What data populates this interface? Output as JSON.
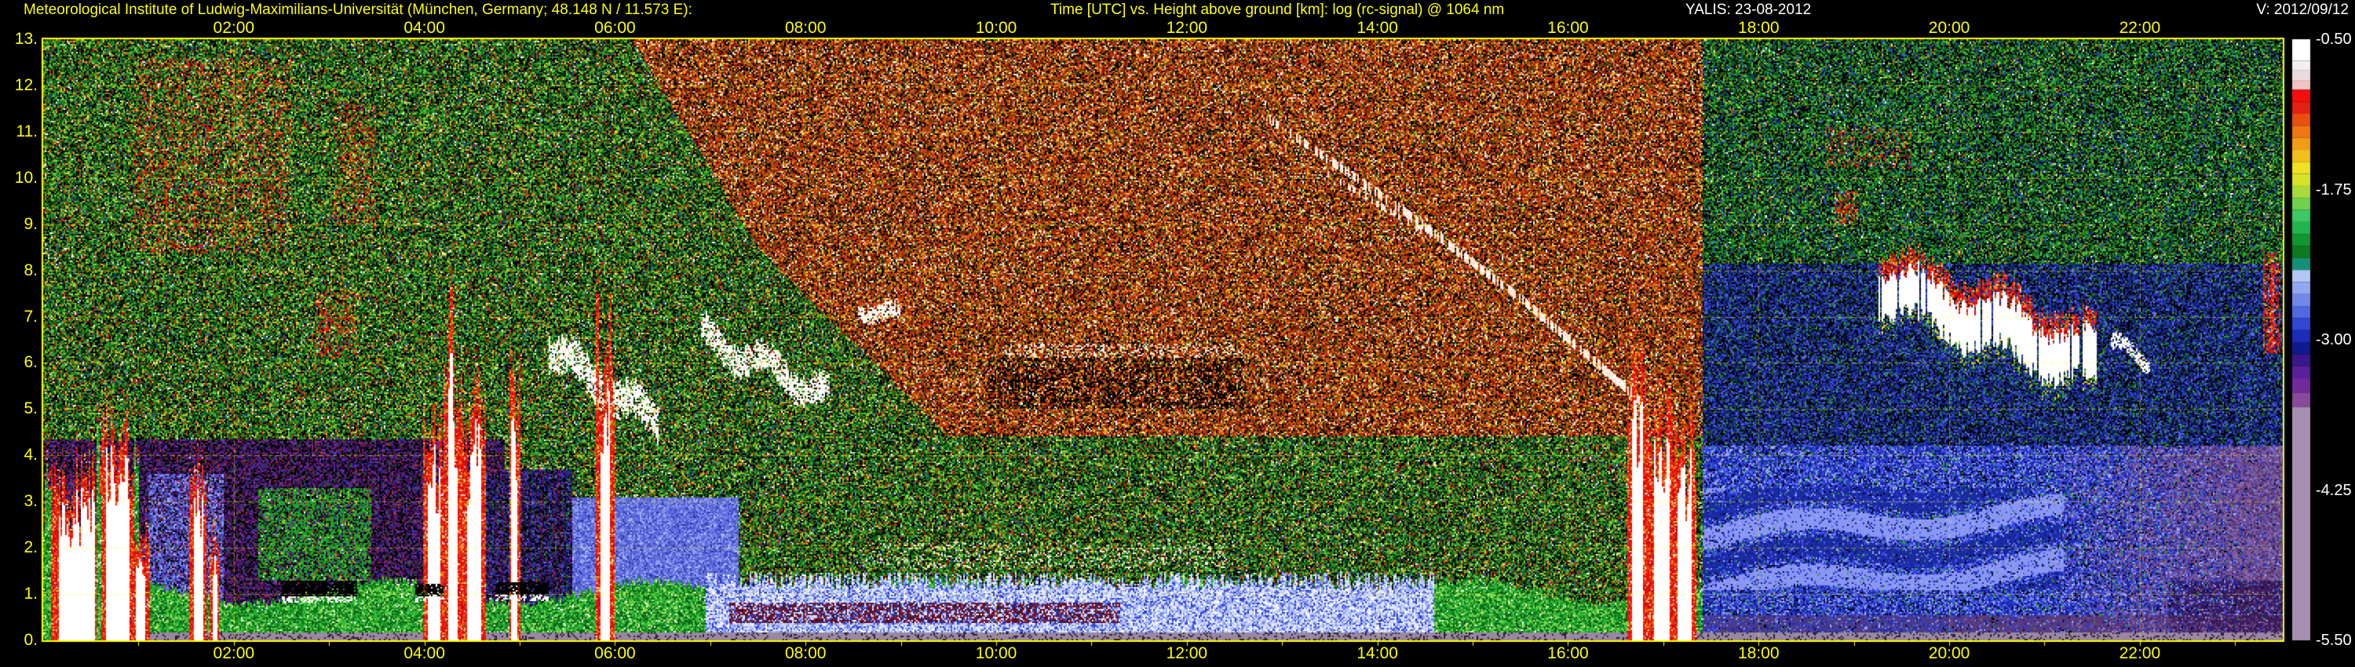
{
  "header": {
    "institute": "Meteorological Institute of Ludwig-Maximilians-Universität (München, Germany; 48.148 N / 11.573 E):",
    "plot_title": "Time [UTC] vs. Height above ground [km]: log (rc-signal) @ 1064 nm",
    "instrument_date": "YALIS: 23-08-2012",
    "version": "V: 2012/09/12"
  },
  "colors": {
    "background": "#000000",
    "axis_accent": "#ffff00",
    "header_text": "#ffff00",
    "header_text_right": "#ffffff",
    "colorbar_label_text": "#ffffff",
    "grid": "rgba(255,255,0,0.5)"
  },
  "chart_data": {
    "type": "heatmap",
    "title": "Time [UTC] vs. Height above ground [km]: log (rc-signal) @ 1064 nm",
    "xlabel": "Time [UTC]",
    "ylabel": "Height above ground [km]",
    "zlabel": "log (rc-signal) @ 1064 nm",
    "date": "23-08-2012",
    "instrument": "YALIS",
    "time_range": [
      0,
      23.5
    ],
    "height_range": [
      0,
      13
    ],
    "grid": "dashed yellow, 1 km horizontal, 2 h vertical",
    "content_summary": "Daytime solar-background speckle noise (green at mid levels, red-brown aloft) until ~17:20 UTC, then dark blue/green night noise; rain/cloud columns near 00:30-01:10, 01:40, 04:05-05:00, 05:50 and 16:45-17:25 reaching 4-6.5 km; boundary layer below ~1 km; descending cirrus arc 13:00-16:45 (11->5 km); night cloud band 19:15-21:35 descending 7.6->6 km; smooth mauve-blue aerosol field after 18:00.",
    "x_axis": {
      "values": [
        2,
        4,
        6,
        8,
        10,
        12,
        14,
        16,
        18,
        20,
        22
      ],
      "labels": [
        "02:00",
        "04:00",
        "06:00",
        "08:00",
        "10:00",
        "12:00",
        "14:00",
        "16:00",
        "18:00",
        "20:00",
        "22:00"
      ]
    },
    "y_axis": {
      "values": [
        0,
        1,
        2,
        3,
        4,
        5,
        6,
        7,
        8,
        9,
        10,
        11,
        12,
        13
      ],
      "labels": [
        "0.",
        "1.",
        "2.",
        "3.",
        "4.",
        "5.",
        "6.",
        "7.",
        "8.",
        "9.",
        "10.",
        "11.",
        "12.",
        "13."
      ]
    },
    "colorbar": {
      "max": -0.5,
      "min": -5.5,
      "values": [
        -0.5,
        -1.75,
        -3.0,
        -4.25,
        -5.5
      ],
      "labels": [
        "-0.50",
        "-1.75",
        "-3.00",
        "-4.25",
        "-5.50"
      ],
      "stops": [
        [
          -0.5,
          "#ffffff"
        ],
        [
          -0.68,
          "#f4eeee"
        ],
        [
          -0.76,
          "#eadcdc"
        ],
        [
          -0.84,
          "#f0c4c4"
        ],
        [
          -0.92,
          "#f60d0d"
        ],
        [
          -1.02,
          "#e32112"
        ],
        [
          -1.12,
          "#ea4f10"
        ],
        [
          -1.22,
          "#f07612"
        ],
        [
          -1.32,
          "#f29c16"
        ],
        [
          -1.42,
          "#f2be1c"
        ],
        [
          -1.52,
          "#f0e224"
        ],
        [
          -1.62,
          "#d8e22a"
        ],
        [
          -1.72,
          "#a8da38"
        ],
        [
          -1.82,
          "#6ed24e"
        ],
        [
          -1.92,
          "#3cc862"
        ],
        [
          -2.02,
          "#22b450"
        ],
        [
          -2.12,
          "#12962e"
        ],
        [
          -2.22,
          "#0b7a22"
        ],
        [
          -2.32,
          "#159078"
        ],
        [
          -2.42,
          "#b6c6f4"
        ],
        [
          -2.52,
          "#93a8f0"
        ],
        [
          -2.62,
          "#7288e8"
        ],
        [
          -2.72,
          "#5068e0"
        ],
        [
          -2.82,
          "#3048d4"
        ],
        [
          -2.92,
          "#1c2cb8"
        ],
        [
          -3.02,
          "#101a8c"
        ],
        [
          -3.12,
          "#38188c"
        ],
        [
          -3.22,
          "#5a1f9a"
        ],
        [
          -3.32,
          "#712a9c"
        ],
        [
          -3.44,
          "#8a4a9c"
        ],
        [
          -3.56,
          "#a78fb2"
        ]
      ]
    },
    "features": {
      "day_night_split": 17.42,
      "rain_columns": [
        {
          "t": 0.35,
          "w": 0.35,
          "top": 3.3,
          "green_fringe": true
        },
        {
          "t": 0.78,
          "w": 0.22,
          "top": 4.2,
          "green_fringe": true
        },
        {
          "t": 1.02,
          "w": 0.1,
          "top": 2.3
        },
        {
          "t": 1.63,
          "w": 0.09,
          "top": 3.5
        },
        {
          "t": 1.8,
          "w": 0.05,
          "top": 2.2
        },
        {
          "t": 4.1,
          "w": 0.12,
          "top": 4.6
        },
        {
          "t": 4.3,
          "w": 0.08,
          "top": 6.3
        },
        {
          "t": 4.52,
          "w": 0.13,
          "top": 4.8
        },
        {
          "t": 4.95,
          "w": 0.06,
          "top": 4.9
        },
        {
          "t": 5.9,
          "w": 0.1,
          "top": 6.5
        },
        {
          "t": 16.73,
          "w": 0.1,
          "top": 5.2
        },
        {
          "t": 16.98,
          "w": 0.15,
          "top": 4.5
        },
        {
          "t": 17.22,
          "w": 0.13,
          "top": 4.2
        }
      ],
      "cloud_streaks": [
        {
          "t0": 5.3,
          "t1": 6.45,
          "h0": 6.3,
          "h1": 4.7,
          "thick": 0.45
        },
        {
          "t0": 6.9,
          "t1": 8.25,
          "h0": 6.6,
          "h1": 5.3,
          "thick": 0.35
        },
        {
          "t0": 8.55,
          "t1": 9.0,
          "h0": 7.3,
          "h1": 6.9,
          "thick": 0.2
        },
        {
          "t0": 21.7,
          "t1": 22.1,
          "h0": 6.3,
          "h1": 6.1,
          "thick": 0.2
        }
      ],
      "night_cloud": {
        "t0": 19.25,
        "t1": 21.55,
        "h0": 7.65,
        "h1": 5.95,
        "thick": 0.55
      },
      "arcs": [
        {
          "pts": [
            [
              12.85,
              11.3
            ],
            [
              14.2,
              9.4
            ],
            [
              15.5,
              7.4
            ],
            [
              16.75,
              5.2
            ]
          ],
          "w": 0.1,
          "gap": 0.5
        },
        {
          "pts": [
            [
              13.3,
              10.3
            ],
            [
              14.6,
              8.7
            ]
          ],
          "w": 0.07,
          "gap": 0.7
        }
      ],
      "red_patches": [
        {
          "t0": 0.95,
          "t1": 2.6,
          "h0": 8.4,
          "h1": 12.6,
          "density": 0.25
        },
        {
          "t0": 3.05,
          "t1": 3.5,
          "h0": 9.0,
          "h1": 11.6,
          "density": 0.3
        },
        {
          "t0": 2.85,
          "t1": 3.3,
          "h0": 6.1,
          "h1": 7.6,
          "density": 0.3
        },
        {
          "t0": 18.7,
          "t1": 19.6,
          "h0": 10.2,
          "h1": 11.1,
          "density": 0.22
        },
        {
          "t0": 18.8,
          "t1": 19.05,
          "h0": 9.0,
          "h1": 9.7,
          "density": 0.5
        },
        {
          "t0": 23.3,
          "t1": 23.48,
          "h0": 6.2,
          "h1": 8.4,
          "density": 0.85
        }
      ],
      "black_blobs": [
        {
          "t0": 2.5,
          "t1": 3.3,
          "h0": 0.95,
          "h1": 1.28,
          "underline": true
        },
        {
          "t0": 3.9,
          "t1": 4.2,
          "h0": 0.95,
          "h1": 1.22,
          "underline": true
        },
        {
          "t0": 4.75,
          "t1": 5.3,
          "h0": 0.98,
          "h1": 1.25,
          "underline": true
        },
        {
          "t0": 9.9,
          "t1": 12.6,
          "h0": 5.0,
          "h1": 6.1,
          "density": 0.4
        }
      ],
      "white_dashes": [
        {
          "t0": 8.6,
          "t1": 12.4,
          "h0": 1.55,
          "h1": 2.1,
          "density": 0.12
        },
        {
          "t0": 10.1,
          "t1": 12.6,
          "h0": 6.1,
          "h1": 6.4,
          "density": 0.2
        }
      ]
    }
  }
}
